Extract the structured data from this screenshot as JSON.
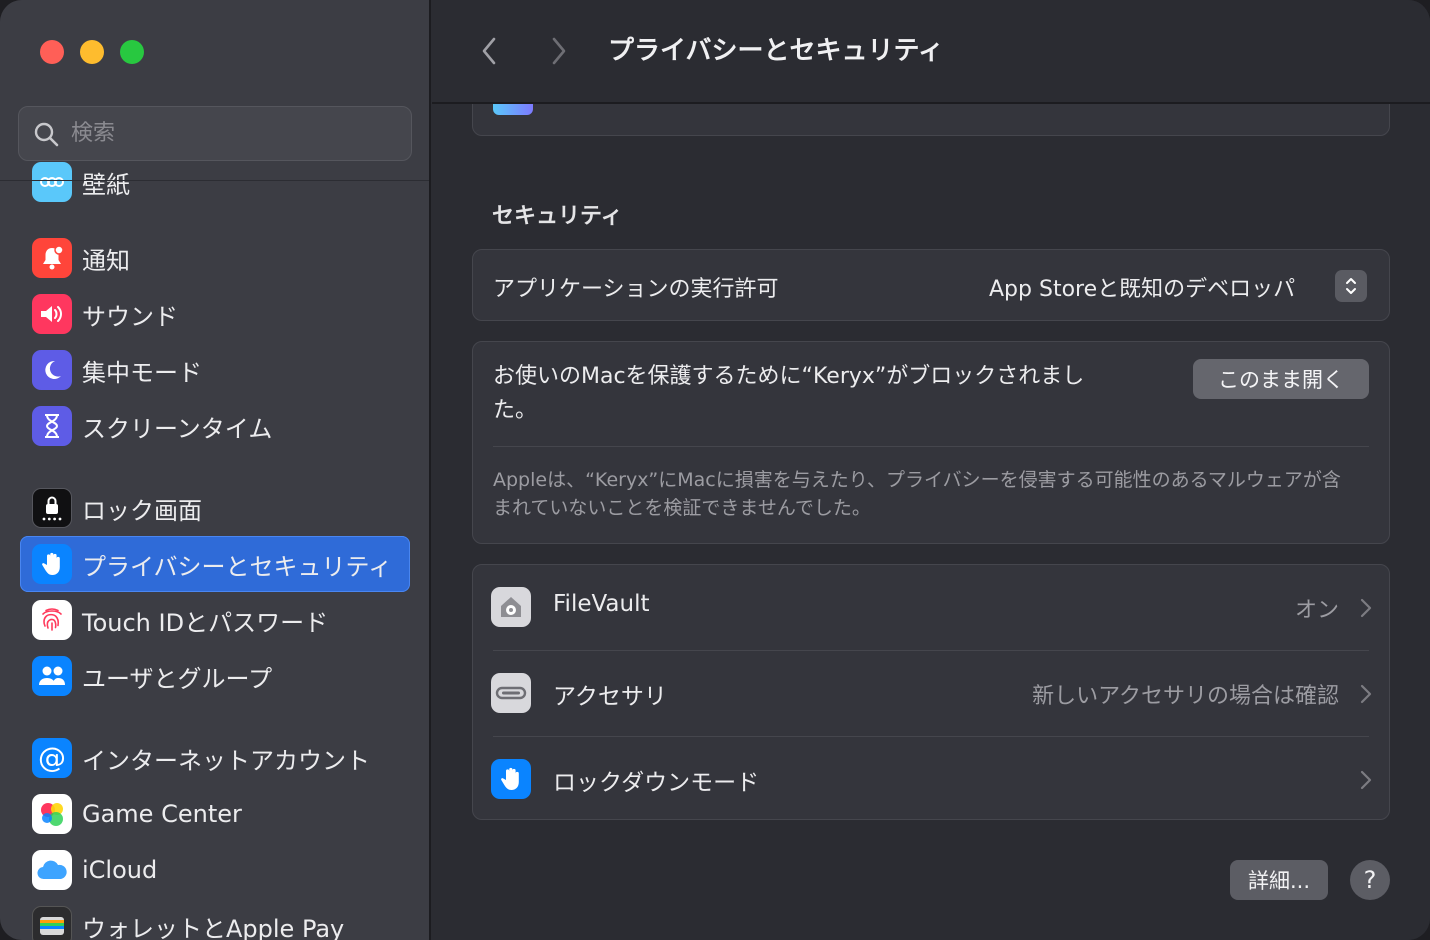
{
  "window": {
    "title": "プライバシーとセキュリティ"
  },
  "sidebar": {
    "search_placeholder": "検索",
    "partial_item_label": "壁紙",
    "items": [
      {
        "label": "通知",
        "icon": "bell-icon",
        "color": "#ff453a"
      },
      {
        "label": "サウンド",
        "icon": "speaker-icon",
        "color": "#ff375f"
      },
      {
        "label": "集中モード",
        "icon": "moon-icon",
        "color": "#5e5ce6"
      },
      {
        "label": "スクリーンタイム",
        "icon": "hourglass-icon",
        "color": "#5e5ce6"
      },
      {
        "label": "ロック画面",
        "icon": "lock-icon",
        "color": "#1c1c1e"
      },
      {
        "label": "プライバシーとセキュリティ",
        "icon": "hand-icon",
        "color": "#0a84ff",
        "active": true
      },
      {
        "label": "Touch IDとパスワード",
        "icon": "fingerprint-icon",
        "color": "#ffffff"
      },
      {
        "label": "ユーザとグループ",
        "icon": "users-icon",
        "color": "#0a84ff"
      },
      {
        "label": "インターネットアカウント",
        "icon": "at-icon",
        "color": "#0a84ff"
      },
      {
        "label": "Game Center",
        "icon": "game-center-icon",
        "color": "#ffffff"
      },
      {
        "label": "iCloud",
        "icon": "cloud-icon",
        "color": "#ffffff"
      },
      {
        "label": "ウォレットとApple Pay",
        "icon": "wallet-icon",
        "color": "#3a3a3c"
      }
    ]
  },
  "main": {
    "section_title": "セキュリティ",
    "app_execution": {
      "label": "アプリケーションの実行許可",
      "value": "App Storeと既知のデベロッパ"
    },
    "blocked": {
      "message": "お使いのMacを保護するために“Keryx”がブロックされました。",
      "open_button": "このまま開く",
      "note": "Appleは、“Keryx”にMacに損害を与えたり、プライバシーを侵害する可能性のあるマルウェアが含まれていないことを検証できませんでした。"
    },
    "rows": [
      {
        "label": "FileVault",
        "value": "オン",
        "icon": "filevault-icon"
      },
      {
        "label": "アクセサリ",
        "value": "新しいアクセサリの場合は確認",
        "icon": "accessory-icon"
      },
      {
        "label": "ロックダウンモード",
        "value": "",
        "icon": "hand-icon"
      }
    ],
    "detail_button": "詳細...",
    "help_button": "?"
  }
}
